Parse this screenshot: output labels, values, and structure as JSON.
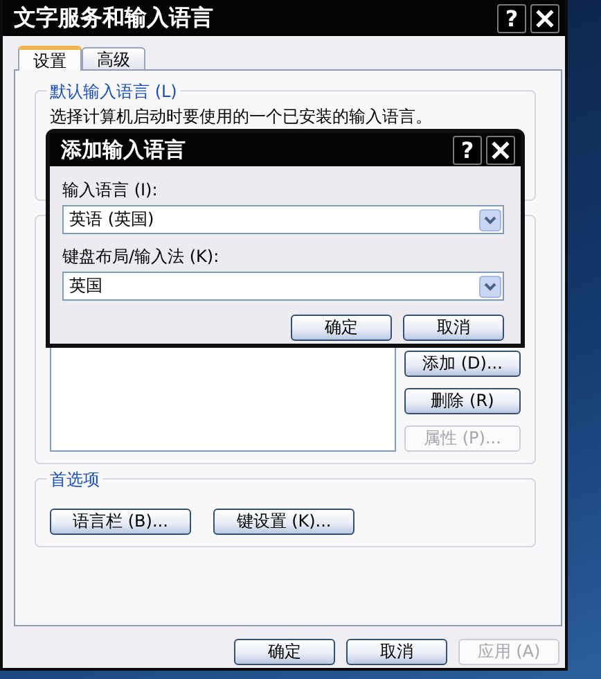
{
  "window": {
    "title": "文字服务和输入语言",
    "help": "?"
  },
  "tabs": [
    {
      "label": "设置",
      "selected": true
    },
    {
      "label": "高级",
      "selected": false
    }
  ],
  "default_language": {
    "title": "默认输入语言 (L)",
    "description": "选择计算机启动时要使用的一个已安装的输入语言。"
  },
  "installed_buttons": [
    {
      "label": "添加 (D)...",
      "disabled": false
    },
    {
      "label": "删除 (R)",
      "disabled": false
    },
    {
      "label": "属性 (P)...",
      "disabled": true
    }
  ],
  "preferences": {
    "title": "首选项",
    "buttons": [
      "语言栏 (B)...",
      "键设置 (K)..."
    ]
  },
  "footer_buttons": [
    {
      "label": "确定",
      "disabled": false
    },
    {
      "label": "取消",
      "disabled": false
    },
    {
      "label": "应用 (A)",
      "disabled": true
    }
  ],
  "dialog": {
    "title": "添加输入语言",
    "help": "?",
    "fields": [
      {
        "label": "输入语言 (I):",
        "value": "英语 (英国)"
      },
      {
        "label": "键盘布局/输入法 (K):",
        "value": "英国"
      }
    ],
    "buttons": [
      "确定",
      "取消"
    ]
  }
}
